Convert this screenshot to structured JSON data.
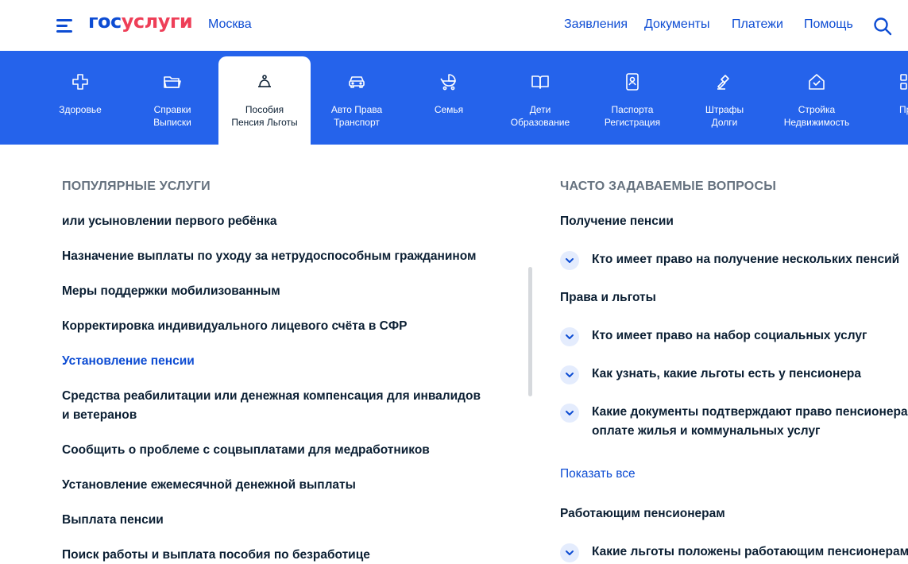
{
  "header": {
    "logo_part1": "гос",
    "logo_part2": "услуги",
    "city": "Москва",
    "nav": [
      "Заявления",
      "Документы",
      "Платежи",
      "Помощь"
    ]
  },
  "colors": {
    "brand_blue": "#0d4cd3",
    "brand_red": "#ee3f58",
    "category_bar": "#2563eb",
    "chevron_bg": "#e4ecfd"
  },
  "categories": [
    {
      "icon": "plus-cross-icon",
      "line1": "Здоровье",
      "line2": ""
    },
    {
      "icon": "folder-icon",
      "line1": "Справки",
      "line2": "Выписки"
    },
    {
      "icon": "bell-icon",
      "line1": "Пособия",
      "line2": "Пенсия Льготы",
      "active": true
    },
    {
      "icon": "car-icon",
      "line1": "Авто Права",
      "line2": "Транспорт"
    },
    {
      "icon": "stroller-icon",
      "line1": "Семья",
      "line2": ""
    },
    {
      "icon": "book-icon",
      "line1": "Дети",
      "line2": "Образование"
    },
    {
      "icon": "passport-icon",
      "line1": "Паспорта",
      "line2": "Регистрация"
    },
    {
      "icon": "gavel-icon",
      "line1": "Штрафы",
      "line2": "Долги"
    },
    {
      "icon": "house-icon",
      "line1": "Стройка",
      "line2": "Недвижимость"
    },
    {
      "icon": "grid-icon",
      "line1": "Про",
      "line2": ""
    }
  ],
  "popular": {
    "title": "ПОПУЛЯРНЫЕ УСЛУГИ",
    "items": [
      "или усыновлении первого ребёнка",
      "Назначение выплаты по уходу за нетрудоспособным гражданином",
      "Меры поддержки мобилизованным",
      "Корректировка индивидуального лицевого счёта в СФР",
      "Установление пенсии",
      "Средства реабилитации или денежная компенсация для инвалидов и ветеранов",
      "Сообщить о проблеме с соцвыплатами для медработников",
      "Установление ежемесячной денежной выплаты",
      "Выплата пенсии",
      "Поиск работы и выплата пособия по безработице"
    ]
  },
  "faq": {
    "title": "ЧАСТО ЗАДАВАЕМЫЕ ВОПРОСЫ",
    "group1": "Получение пенсии",
    "q1": "Кто имеет право на получение нескольких пенсий",
    "group2": "Права и льготы",
    "q2": "Кто имеет право на набор социальных услуг",
    "q3": "Как узнать, какие льготы есть у пенсионера",
    "q4_line1": "Какие документы подтверждают право пенсионера на",
    "q4_line2": "оплате жилья и коммунальных услуг",
    "show_all": "Показать все",
    "group3": "Работающим пенсионерам",
    "q5": "Какие льготы положены работающим пенсионерам"
  }
}
